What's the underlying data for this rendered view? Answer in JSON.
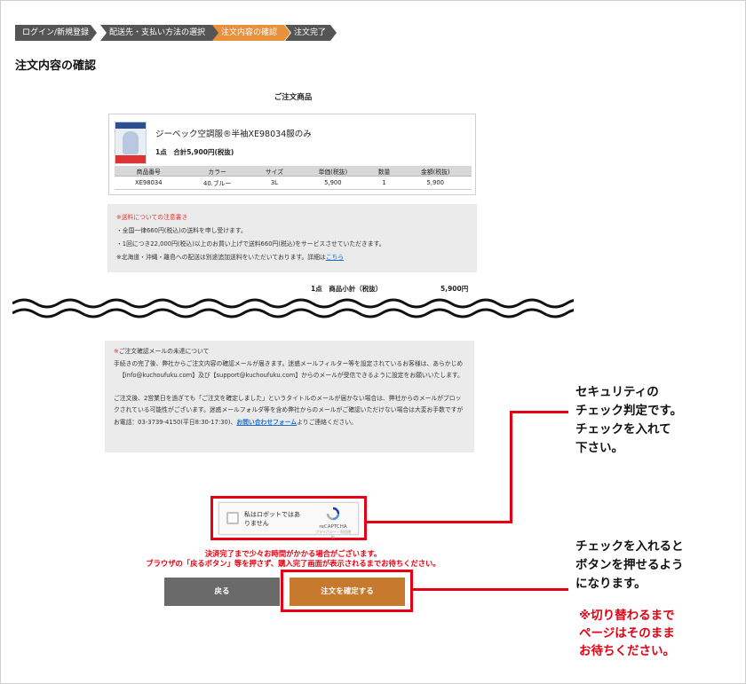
{
  "breadcrumb": {
    "steps": [
      "ログイン/新規登録",
      "配送先・支払い方法の選択",
      "注文内容の確認",
      "注文完了"
    ],
    "active_index": 2
  },
  "page_title": "注文内容の確認",
  "order_section_title": "ご注文商品",
  "product": {
    "name": "ジーベック空調服®半袖XE98034服のみ",
    "qty_total": "1点　合計5,900円(税抜)",
    "columns": [
      "商品番号",
      "カラー",
      "サイズ",
      "単価(税抜)",
      "数量",
      "金額(税抜)"
    ],
    "row": [
      "XE98034",
      "40.ブルー",
      "3L",
      "5,900",
      "1",
      "5,900"
    ]
  },
  "shipping_notice": {
    "heading": "※送料についての注意書き",
    "line1": "・全国一律660円(税込)の送料を申し受けます。",
    "line2": "・1回につき22,000円(税込)以上のお買い上げで送料660円(税込)をサービスさせていただきます。",
    "line3": "※北海道・沖縄・離島への配送は別途追加送料をいただいております。詳細は",
    "link": "こちら"
  },
  "subtotal": {
    "label": "1点　商品小計（税抜）",
    "amount": "5,900円"
  },
  "mail_notice": {
    "heading_mark": "※",
    "heading": "ご注文確認メールの未達について",
    "p1": "手続きの完了後、弊社からご注文内容の確認メールが届きます。迷惑メールフィルター等を設定されているお客様は、あらかじめ",
    "p2": "【info@kuchoufuku.com】及び【support@kuchoufuku.com】からのメールが受信できるように設定をお願いいたします。",
    "p3": "ご注文後、2営業日を過ぎても「ご注文を確定しました」というタイトルのメールが届かない場合は、弊社からのメールがブロックされている可能性がございます。迷惑メールフォルダ等を含め弊社からのメールがご確認いただけない場合は大変お手数ですがお電話：03-3739-4150(平日8:30-17:30)、",
    "link": "お問い合わせフォーム",
    "p3_end": "よりご連絡ください。"
  },
  "recaptcha": {
    "label": "私はロボットではありません",
    "brand": "reCAPTCHA",
    "terms": "プライバシー・利用規約"
  },
  "warning": {
    "line1": "決済完了まで少々お時間がかかる場合がございます。",
    "line2": "ブラウザの「戻るボタン」等を押さず、購入完了画面が表示されるまでお待ちください。"
  },
  "buttons": {
    "back": "戻る",
    "confirm": "注文を確定する"
  },
  "callouts": {
    "security": [
      "セキュリティの",
      "チェック判定です。",
      "チェックを入れて",
      "下さい。"
    ],
    "button": [
      "チェックを入れると",
      "ボタンを押せるよう",
      "になります。"
    ],
    "note": [
      "※切り替わるまで",
      "ページはそのまま",
      "お待ちください。"
    ]
  },
  "colors": {
    "active_step": "#e8913a",
    "step": "#555555",
    "highlight": "#e60012",
    "confirm_button": "#c77a2d",
    "back_button": "#6a6a6a"
  }
}
